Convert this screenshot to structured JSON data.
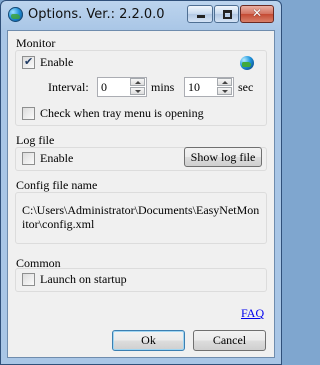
{
  "window": {
    "title": "Options.  Ver.: 2.2.0.0"
  },
  "title_controls": {
    "close_glyph": "✕"
  },
  "monitor": {
    "group_label": "Monitor",
    "enable_label": "Enable",
    "enable_checked": true,
    "interval_label": "Interval:",
    "mins_value": "0",
    "mins_unit": "mins",
    "sec_value": "10",
    "sec_unit": "sec",
    "tray_check_label": "Check when tray menu is opening",
    "tray_check_checked": false
  },
  "log_file": {
    "group_label": "Log file",
    "enable_label": "Enable",
    "enable_checked": false,
    "show_log_button": "Show log file"
  },
  "config": {
    "group_label": "Config file name",
    "path": "C:\\Users\\Administrator\\Documents\\EasyNetMonitor\\config.xml"
  },
  "common": {
    "group_label": "Common",
    "launch_label": "Launch on startup",
    "launch_checked": false
  },
  "footer": {
    "faq_link": "FAQ",
    "ok_button": "Ok",
    "cancel_button": "Cancel"
  }
}
